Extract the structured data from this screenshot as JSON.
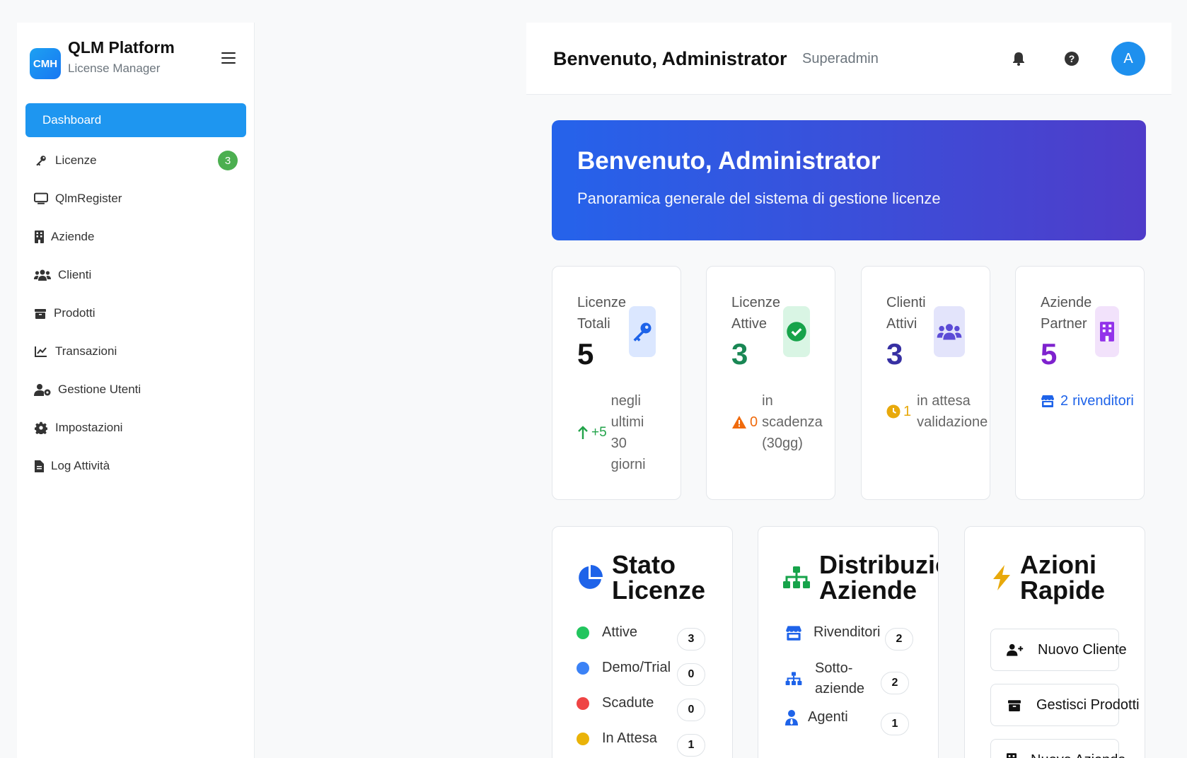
{
  "brand": {
    "logo_text": "CMH",
    "title": "QLM Platform",
    "subtitle": "License Manager"
  },
  "sidebar": {
    "items": [
      {
        "label": "Dashboard",
        "icon": "dashboard",
        "active": true
      },
      {
        "label": "Licenze",
        "icon": "key-icon",
        "badge": "3"
      },
      {
        "label": "QlmRegister",
        "icon": "monitor-icon"
      },
      {
        "label": "Aziende",
        "icon": "building-icon"
      },
      {
        "label": "Clienti",
        "icon": "users-icon"
      },
      {
        "label": "Prodotti",
        "icon": "box-icon"
      },
      {
        "label": "Transazioni",
        "icon": "chart-line-icon"
      },
      {
        "label": "Gestione Utenti",
        "icon": "user-gear-icon"
      },
      {
        "label": "Impostazioni",
        "icon": "gear-icon"
      },
      {
        "label": "Log Attività",
        "icon": "file-icon"
      }
    ]
  },
  "topbar": {
    "title": "Benvenuto, Administrator",
    "role": "Superadmin",
    "avatar": "A"
  },
  "hero": {
    "title": "Benvenuto, Administrator",
    "subtitle": "Panoramica generale del sistema di gestione licenze"
  },
  "stats": [
    {
      "label": "Licenze Totali",
      "value": "5",
      "foot_num": "+5",
      "foot_text": "negli ultimi 30 giorni",
      "color": "#111111",
      "accent": "#1e63e9"
    },
    {
      "label": "Licenze Attive",
      "value": "3",
      "foot_num": "0",
      "foot_text": "in scadenza (30gg)",
      "color": "#198754",
      "accent": "#f06a0c"
    },
    {
      "label": "Clienti Attivi",
      "value": "3",
      "foot_num": "1",
      "foot_text": "in attesa validazione",
      "color": "#3730a3",
      "accent": "#e8a90b"
    },
    {
      "label": "Aziende Partner",
      "value": "5",
      "foot_num": "2",
      "foot_text": "rivenditori",
      "color": "#7e22ce",
      "accent": "#1e63e9"
    }
  ],
  "cards": {
    "stato": {
      "title_1": "Stato",
      "title_2": "Licenze",
      "rows": [
        {
          "label": "Attive",
          "count": "3",
          "color": "#22c55e"
        },
        {
          "label": "Demo/Trial",
          "count": "0",
          "color": "#3b82f6"
        },
        {
          "label": "Scadute",
          "count": "0",
          "color": "#ef4444"
        },
        {
          "label": "In Attesa",
          "count": "1",
          "color": "#eab308"
        }
      ]
    },
    "distribuzione": {
      "title_1": "Distribuzione",
      "title_2": "Aziende",
      "rows": [
        {
          "label": "Rivenditori",
          "count": "2"
        },
        {
          "label_1": "Sotto-",
          "label_2": "aziende",
          "count": "2"
        },
        {
          "label": "Agenti",
          "count": "1"
        }
      ]
    },
    "azioni": {
      "title_1": "Azioni",
      "title_2": "Rapide",
      "buttons": [
        "Nuovo Cliente",
        "Gestisci Prodotti",
        "Nuova Azienda"
      ]
    }
  }
}
